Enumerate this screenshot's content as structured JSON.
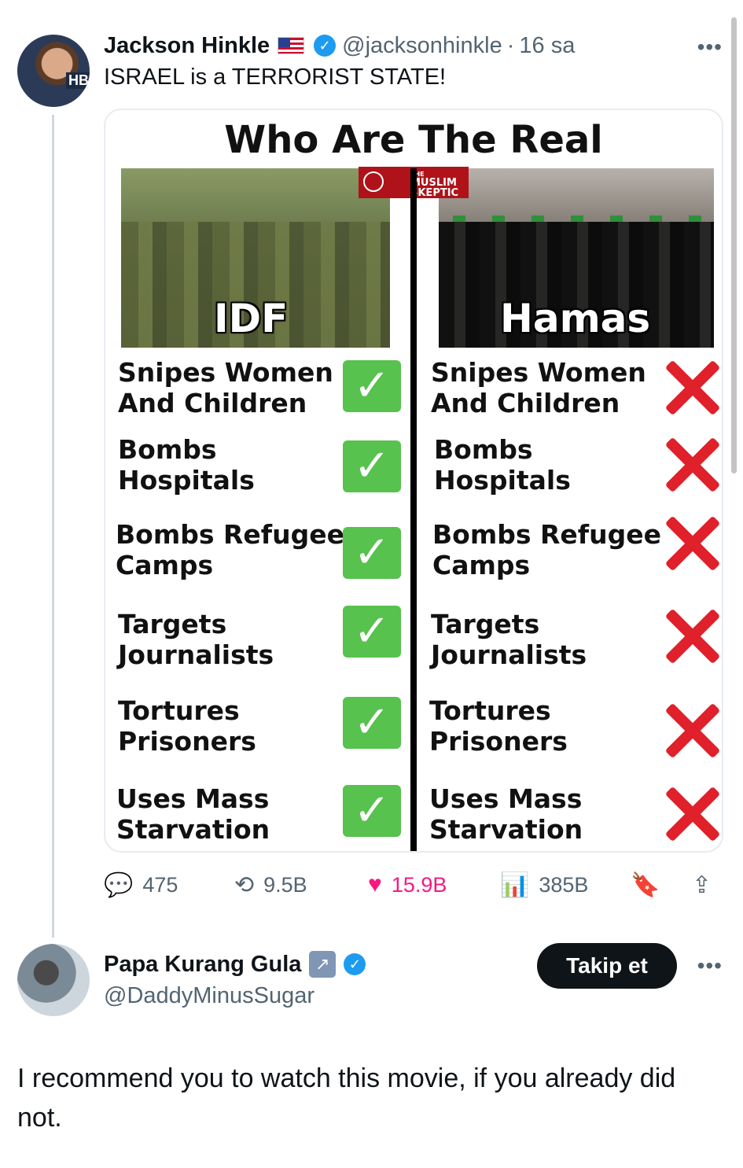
{
  "tweet": {
    "author_name": "Jackson Hinkle",
    "author_handle": "@jacksonhinkle",
    "separator": "·",
    "time": "16 sa",
    "avatar_badge": "HB",
    "more_label": "•••",
    "text": "ISRAEL is a TERRORIST STATE!",
    "media": {
      "title": "Who Are The Real Terrorists?",
      "logo_top": "THE",
      "logo_line1": "MUSLIM",
      "logo_line2": "SKEPTIC",
      "left_label": "IDF",
      "right_label": "Hamas",
      "rows": [
        {
          "line1": "Snipes Women",
          "line2": "And Children",
          "idf": "check",
          "hamas": "cross"
        },
        {
          "line1": "Bombs",
          "line2": "Hospitals",
          "idf": "check",
          "hamas": "cross"
        },
        {
          "line1": "Bombs Refugee",
          "line2": "Camps",
          "idf": "check",
          "hamas": "cross"
        },
        {
          "line1": "Targets",
          "line2": "Journalists",
          "idf": "check",
          "hamas": "cross"
        },
        {
          "line1": "Tortures",
          "line2": "Prisoners",
          "idf": "check",
          "hamas": "cross"
        },
        {
          "line1": "Uses Mass",
          "line2": "Starvation",
          "idf": "check",
          "hamas": "cross"
        }
      ],
      "check_glyph": "✓",
      "colors": {
        "check": "#57c24d",
        "cross": "#e0202a"
      }
    },
    "actions": {
      "replies": "475",
      "reposts": "9.5B",
      "likes": "15.9B",
      "views": "385B"
    },
    "icons": {
      "reply": "💬",
      "repost": "⟲",
      "like": "♥",
      "views": "📊",
      "bookmark": "🔖",
      "share": "⇪"
    }
  },
  "reply": {
    "author_name": "Papa Kurang Gula",
    "author_handle": "@DaddyMinusSugar",
    "follow_label": "Takip et",
    "more_label": "•••",
    "text": "I recommend you to watch this movie, if you already did not."
  },
  "colors": {
    "verified": "#1d9bf0",
    "like": "#f91880",
    "muted": "#536471"
  }
}
